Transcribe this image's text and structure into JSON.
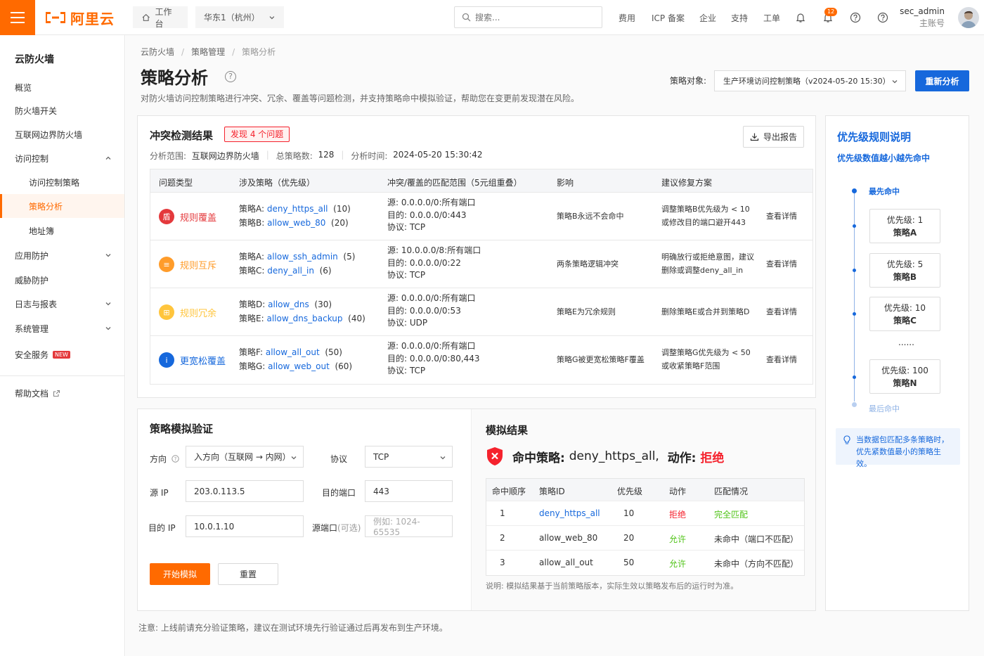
{
  "topbar": {
    "logo_text": "阿里云",
    "workbench_label": "工作台",
    "region_label": "华东1（杭州）",
    "search_placeholder": "搜索...",
    "nav": [
      "费用",
      "ICP 备案",
      "企业",
      "支持",
      "工单"
    ],
    "notif_count": "12",
    "user_name": "sec_admin",
    "user_role": "主账号"
  },
  "sidebar": {
    "title": "云防火墙",
    "items": [
      {
        "label": "概览"
      },
      {
        "label": "防火墙开关"
      },
      {
        "label": "互联网边界防火墙"
      },
      {
        "label": "访问控制"
      },
      {
        "label": "访问控制策略"
      },
      {
        "label": "策略分析"
      },
      {
        "label": "地址簿"
      },
      {
        "label": "应用防护"
      },
      {
        "label": "威胁防护"
      },
      {
        "label": "日志与报表"
      },
      {
        "label": "系统管理"
      },
      {
        "label": "安全服务",
        "tag": "NEW"
      },
      {
        "label": "帮助文档"
      }
    ]
  },
  "breadcrumb": [
    "云防火墙",
    "策略管理",
    "策略分析"
  ],
  "page": {
    "title": "策略分析",
    "description": "对防火墙访问控制策略进行冲突、冗余、覆盖等问题检测，并支持策略命中模拟验证，帮助您在变更前发现潜在风险。",
    "target_label": "策略对象:",
    "target_value": "生产环境访问控制策略（v2024-05-20 15:30）",
    "reanalyze_label": "重新分析"
  },
  "conflict": {
    "title": "冲突检测结果",
    "issue_tag": "发现 4 个问题",
    "export_label": "导出报告",
    "meta_scope_label": "分析范围:",
    "meta_scope": "互联网边界防火墙",
    "meta_total_label": "总策略数:",
    "meta_total": "128",
    "meta_time_label": "分析时间:",
    "meta_time": "2024-05-20 15:30:42",
    "headers": [
      "问题类型",
      "涉及策略（优先级）",
      "冲突/覆盖的匹配范围（5元组重叠）",
      "影响",
      "建议修复方案"
    ],
    "rows": [
      {
        "type": "规则覆盖",
        "color": "#e4393c",
        "icon": "盾",
        "p1_label": "策略A:",
        "p1_name": "deny_https_all",
        "p1_prio": "(10)",
        "p2_label": "策略B:",
        "p2_name": "allow_web_80",
        "p2_prio": "(20)",
        "src": "源:  0.0.0.0/0:所有端口",
        "dst": "目的:  0.0.0.0/0:443",
        "proto": "协议:  TCP",
        "impact": "策略B永远不会命中",
        "fix1": "调整策略B优先级为 < 10",
        "fix2": "或修改目的端口避开443",
        "detail": "查看详情"
      },
      {
        "type": "规则互斥",
        "color": "#ff9c2a",
        "icon": "≡",
        "p1_label": "策略A:",
        "p1_name": "allow_ssh_admin",
        "p1_prio": "(5)",
        "p2_label": "策略C:",
        "p2_name": "deny_all_in",
        "p2_prio": "(6)",
        "src": "源:  10.0.0.0/8:所有端口",
        "dst": "目的:  0.0.0.0/0:22",
        "proto": "协议:  TCP",
        "impact": "两条策略逻辑冲突",
        "fix1": "明确放行或拒绝意图，建议",
        "fix2": "删除或调整deny_all_in",
        "detail": "查看详情"
      },
      {
        "type": "规则冗余",
        "color": "#ffc53d",
        "icon": "⊞",
        "p1_label": "策略D:",
        "p1_name": "allow_dns",
        "p1_prio": "(30)",
        "p2_label": "策略E:",
        "p2_name": "allow_dns_backup",
        "p2_prio": "(40)",
        "src": "源:  0.0.0.0/0:所有端口",
        "dst": "目的:  0.0.0.0/0:53",
        "proto": "协议:  UDP",
        "impact": "策略E为冗余规则",
        "fix1": "删除策略E或合并到策略D",
        "fix2": "",
        "detail": "查看详情"
      },
      {
        "type": "更宽松覆盖",
        "color": "#1668dc",
        "icon": "i",
        "p1_label": "策略F:",
        "p1_name": "allow_all_out",
        "p1_prio": "(50)",
        "p2_label": "策略G:",
        "p2_name": "allow_web_out",
        "p2_prio": "(60)",
        "src": "源:  0.0.0.0/0:所有端口",
        "dst": "目的:  0.0.0.0/0:80,443",
        "proto": "协议:  TCP",
        "impact": "策略G被更宽松策略F覆盖",
        "fix1": "调整策略G优先级为 < 50",
        "fix2": "或收紧策略F范围",
        "detail": "查看详情"
      }
    ]
  },
  "simulation": {
    "title": "策略模拟验证",
    "direction_label": "方向",
    "direction_value": "入方向（互联网 → 内网）",
    "protocol_label": "协议",
    "protocol_value": "TCP",
    "src_ip_label": "源 IP",
    "src_ip_value": "203.0.113.5",
    "dst_port_label": "目的端口",
    "dst_port_value": "443",
    "dst_ip_label": "目的 IP",
    "dst_ip_value": "10.0.1.10",
    "src_port_label": "源端口",
    "src_port_optional": "(可选)",
    "src_port_placeholder": "例如: 1024-65535",
    "start_label": "开始模拟",
    "reset_label": "重置"
  },
  "result": {
    "title": "模拟结果",
    "hit_prefix": "命中策略:",
    "hit_policy": "deny_https_all,",
    "action_prefix": "动作:",
    "action_value": "拒绝",
    "headers": [
      "命中顺序",
      "策略ID",
      "优先级",
      "动作",
      "匹配情况"
    ],
    "rows": [
      {
        "order": "1",
        "id": "deny_https_all",
        "prio": "10",
        "action": "拒绝",
        "match": "完全匹配",
        "action_color": "#f5222d",
        "match_color": "#52c41a",
        "id_color": "#1668dc"
      },
      {
        "order": "2",
        "id": "allow_web_80",
        "prio": "20",
        "action": "允许",
        "match": "未命中（端口不匹配）",
        "action_color": "#52c41a",
        "match_color": "#333333",
        "id_color": "#333333"
      },
      {
        "order": "3",
        "id": "allow_all_out",
        "prio": "50",
        "action": "允许",
        "match": "未命中（方向不匹配）",
        "action_color": "#52c41a",
        "match_color": "#333333",
        "id_color": "#333333"
      }
    ],
    "note": "说明:  模拟结果基于当前策略版本，实际生效以策略发布后的运行时为准。"
  },
  "footnote": "注意:  上线前请充分验证策略，建议在测试环境先行验证通过后再发布到生产环境。",
  "priority_panel": {
    "title": "优先级规则说明",
    "subtitle": "优先级数值越小越先命中",
    "first_label": "最先命中",
    "last_label": "最后命中",
    "ellipsis": "......",
    "boxes": [
      {
        "prio": "优先级:  1",
        "name": "策略A"
      },
      {
        "prio": "优先级:  5",
        "name": "策略B"
      },
      {
        "prio": "优先级:  10",
        "name": "策略C"
      },
      {
        "prio": "优先级:  100",
        "name": "策略N"
      }
    ],
    "tip": "当数据包匹配多条策略时，优先紧数值最小的策略生效。"
  },
  "colors": {
    "accent": "#ff6a00",
    "primary": "#1668dc",
    "danger": "#f5222d",
    "success": "#52c41a"
  }
}
